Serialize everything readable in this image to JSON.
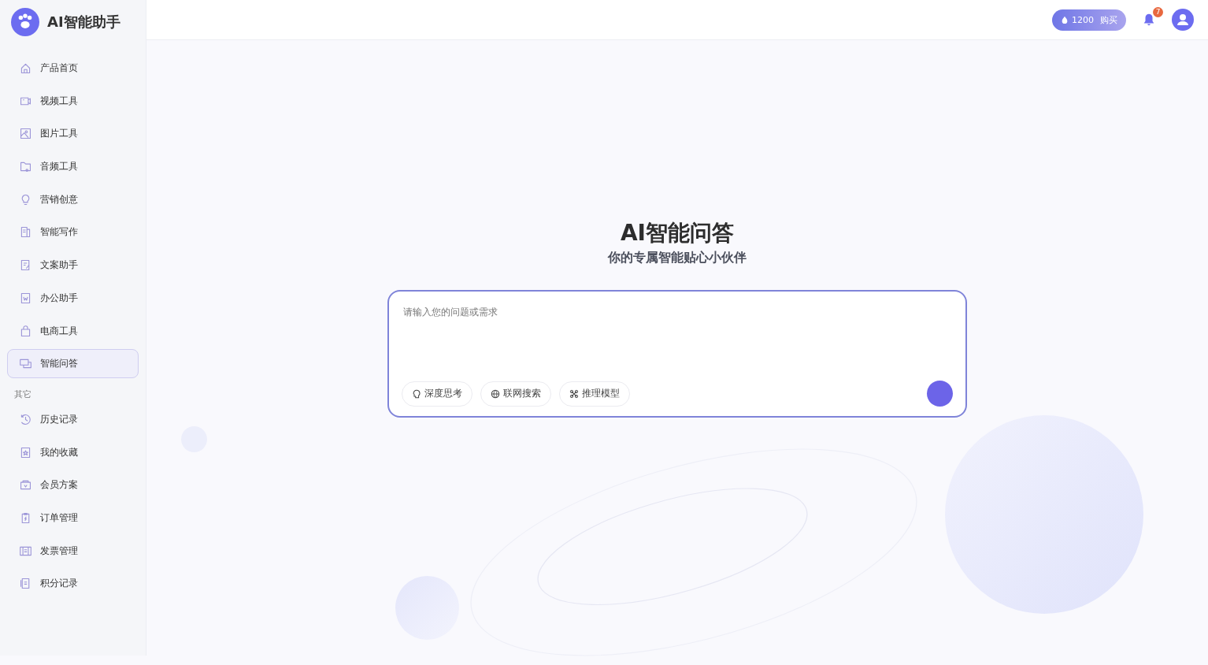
{
  "app": {
    "title": "AI智能助手"
  },
  "sidebar": {
    "items": [
      {
        "label": "产品首页",
        "selected": false
      },
      {
        "label": "视频工具",
        "selected": false
      },
      {
        "label": "图片工具",
        "selected": false
      },
      {
        "label": "音频工具",
        "selected": false
      },
      {
        "label": "营销创意",
        "selected": false
      },
      {
        "label": "智能写作",
        "selected": false
      },
      {
        "label": "文案助手",
        "selected": false
      },
      {
        "label": "办公助手",
        "selected": false
      },
      {
        "label": "电商工具",
        "selected": false
      },
      {
        "label": "智能问答",
        "selected": true
      }
    ],
    "section_title": "其它",
    "other_items": [
      {
        "label": "历史记录",
        "selected": false
      },
      {
        "label": "我的收藏",
        "selected": false
      },
      {
        "label": "会员方案",
        "selected": false
      },
      {
        "label": "订单管理",
        "selected": false
      },
      {
        "label": "发票管理",
        "selected": false
      },
      {
        "label": "积分记录",
        "selected": false
      }
    ]
  },
  "header": {
    "points": "1200",
    "buy": "购买",
    "notification_count": "7"
  },
  "main": {
    "title": "AI智能问答",
    "subtitle": "你的专属智能贴心小伙伴",
    "input": {
      "placeholder": "请输入您的问题或需求"
    },
    "chips": [
      {
        "label": "深度思考"
      },
      {
        "label": "联网搜索"
      },
      {
        "label": "推理模型"
      }
    ]
  }
}
